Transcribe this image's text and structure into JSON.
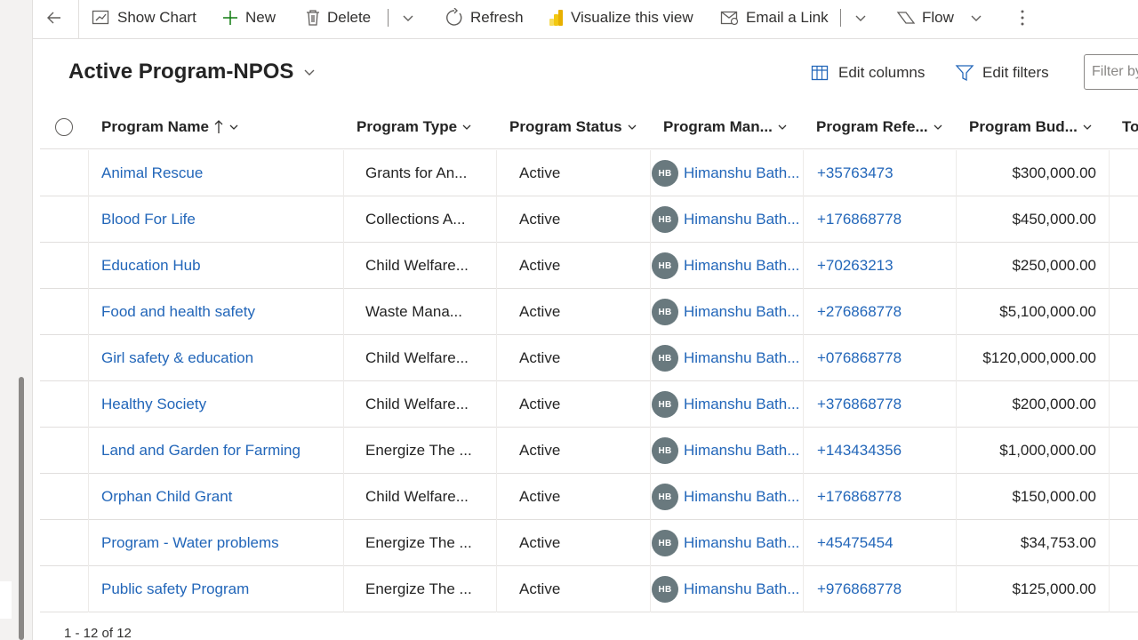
{
  "commandbar": {
    "show_chart": "Show Chart",
    "new": "New",
    "delete": "Delete",
    "refresh": "Refresh",
    "visualize": "Visualize this view",
    "email_link": "Email a Link",
    "flow": "Flow"
  },
  "view": {
    "title": "Active Program-NPOS",
    "edit_columns": "Edit columns",
    "edit_filters": "Edit filters",
    "filter_placeholder": "Filter by keyword"
  },
  "columns": [
    {
      "label": "Program Name",
      "sorted": "ascending"
    },
    {
      "label": "Program Type"
    },
    {
      "label": "Program Status"
    },
    {
      "label": "Program Man..."
    },
    {
      "label": "Program Refe..."
    },
    {
      "label": "Program Bud..."
    },
    {
      "label": "To"
    }
  ],
  "rows": [
    {
      "name": "Animal Rescue",
      "type": "Grants for An...",
      "status": "Active",
      "initials": "HB",
      "manager": "Himanshu Bath...",
      "ref": "+35763473",
      "budget": "$300,000.00"
    },
    {
      "name": "Blood For Life",
      "type": "Collections A...",
      "status": "Active",
      "initials": "HB",
      "manager": "Himanshu Bath...",
      "ref": "+176868778",
      "budget": "$450,000.00"
    },
    {
      "name": "Education Hub",
      "type": "Child Welfare...",
      "status": "Active",
      "initials": "HB",
      "manager": "Himanshu Bath...",
      "ref": "+70263213",
      "budget": "$250,000.00"
    },
    {
      "name": "Food and health safety",
      "type": "Waste Mana...",
      "status": "Active",
      "initials": "HB",
      "manager": "Himanshu Bath...",
      "ref": "+276868778",
      "budget": "$5,100,000.00"
    },
    {
      "name": "Girl safety & education",
      "type": "Child Welfare...",
      "status": "Active",
      "initials": "HB",
      "manager": "Himanshu Bath...",
      "ref": "+076868778",
      "budget": "$120,000,000.00"
    },
    {
      "name": "Healthy Society",
      "type": "Child Welfare...",
      "status": "Active",
      "initials": "HB",
      "manager": "Himanshu Bath...",
      "ref": "+376868778",
      "budget": "$200,000.00"
    },
    {
      "name": "Land and Garden for Farming",
      "type": "Energize The ...",
      "status": "Active",
      "initials": "HB",
      "manager": "Himanshu Bath...",
      "ref": "+143434356",
      "budget": "$1,000,000.00"
    },
    {
      "name": "Orphan Child Grant",
      "type": "Child Welfare...",
      "status": "Active",
      "initials": "HB",
      "manager": "Himanshu Bath...",
      "ref": "+176868778",
      "budget": "$150,000.00"
    },
    {
      "name": "Program - Water problems",
      "type": "Energize The ...",
      "status": "Active",
      "initials": "HB",
      "manager": "Himanshu Bath...",
      "ref": "+45475454",
      "budget": "$34,753.00"
    },
    {
      "name": "Public safety Program",
      "type": "Energize The ...",
      "status": "Active",
      "initials": "HB",
      "manager": "Himanshu Bath...",
      "ref": "+976868778",
      "budget": "$125,000.00"
    }
  ],
  "footer": {
    "count": "1 - 12 of 12"
  },
  "colors": {
    "link": "#2266b9",
    "avatar": "#69797e",
    "powerbi": "#f2c811"
  }
}
